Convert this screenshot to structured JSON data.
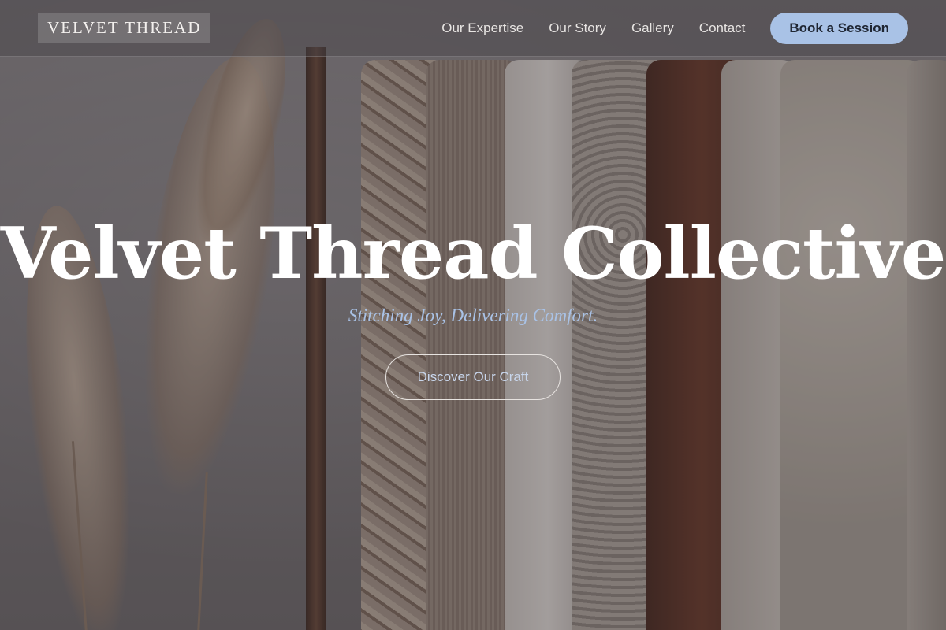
{
  "header": {
    "logo": "VELVET THREAD",
    "nav": [
      "Our Expertise",
      "Our Story",
      "Gallery",
      "Contact"
    ],
    "cta": "Book a Session"
  },
  "hero": {
    "title": "Velvet Thread Collective",
    "tagline": "Stitching Joy, Delivering Comfort.",
    "button": "Discover Our Craft"
  },
  "colors": {
    "accent": "#a9c2e6",
    "cta_text": "#1f2633",
    "title": "#ffffff"
  }
}
